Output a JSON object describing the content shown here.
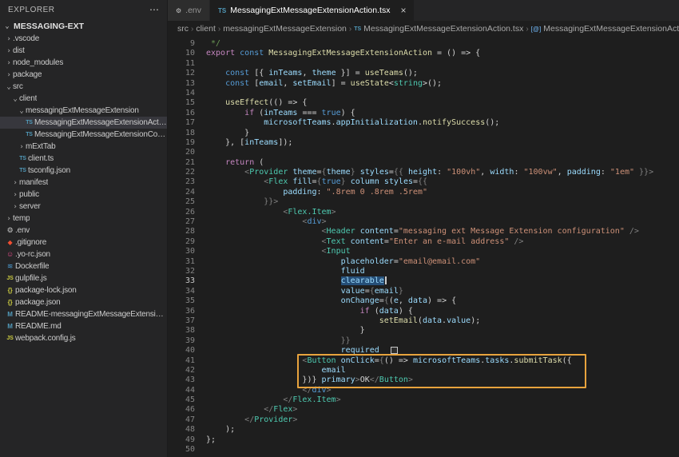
{
  "colors": {
    "accent_box": "#e8a33d",
    "selection": "#264f78"
  },
  "icon_glyphs": {
    "ts": "TS",
    "gear": "⚙",
    "git": "◆",
    "yo": "☺",
    "docker": "≋",
    "js": "JS",
    "json": "{}",
    "md": "M",
    "folder_collapsed": "›",
    "folder_expanded": "⌄",
    "symbol": "[@]",
    "close": "×",
    "more": "⋯",
    "separator": "›"
  },
  "explorer": {
    "title": "EXPLORER",
    "section": "MESSAGING-EXT",
    "items": [
      {
        "label": ".vscode",
        "kind": "folder",
        "indent": 0
      },
      {
        "label": "dist",
        "kind": "folder",
        "indent": 0
      },
      {
        "label": "node_modules",
        "kind": "folder",
        "indent": 0
      },
      {
        "label": "package",
        "kind": "folder",
        "indent": 0
      },
      {
        "label": "src",
        "kind": "folder",
        "indent": 0,
        "expanded": true
      },
      {
        "label": "client",
        "kind": "folder",
        "indent": 1,
        "expanded": true
      },
      {
        "label": "messagingExtMessageExtension",
        "kind": "folder",
        "indent": 2,
        "expanded": true
      },
      {
        "label": "MessagingExtMessageExtensionAction.tsx",
        "kind": "ts",
        "indent": 3,
        "selected": true
      },
      {
        "label": "MessagingExtMessageExtensionConfig.tsx",
        "kind": "ts",
        "indent": 3
      },
      {
        "label": "mExtTab",
        "kind": "folder",
        "indent": 2
      },
      {
        "label": "client.ts",
        "kind": "ts",
        "indent": 2
      },
      {
        "label": "tsconfig.json",
        "kind": "ts",
        "indent": 2
      },
      {
        "label": "manifest",
        "kind": "folder",
        "indent": 1
      },
      {
        "label": "public",
        "kind": "folder",
        "indent": 1
      },
      {
        "label": "server",
        "kind": "folder",
        "indent": 1
      },
      {
        "label": "temp",
        "kind": "folder",
        "indent": 0
      },
      {
        "label": ".env",
        "kind": "gear",
        "indent": 0
      },
      {
        "label": ".gitignore",
        "kind": "git",
        "indent": 0
      },
      {
        "label": ".yo-rc.json",
        "kind": "yo",
        "indent": 0
      },
      {
        "label": "Dockerfile",
        "kind": "docker",
        "indent": 0
      },
      {
        "label": "gulpfile.js",
        "kind": "js",
        "indent": 0
      },
      {
        "label": "package-lock.json",
        "kind": "json",
        "indent": 0
      },
      {
        "label": "package.json",
        "kind": "json",
        "indent": 0
      },
      {
        "label": "README-messagingExtMessageExtensionBot....",
        "kind": "md",
        "indent": 0
      },
      {
        "label": "README.md",
        "kind": "md",
        "indent": 0
      },
      {
        "label": "webpack.config.js",
        "kind": "js",
        "indent": 0
      }
    ]
  },
  "tabs": [
    {
      "label": ".env",
      "icon": "gear",
      "active": false
    },
    {
      "label": "MessagingExtMessageExtensionAction.tsx",
      "icon": "ts",
      "active": true,
      "close_label": "×"
    }
  ],
  "breadcrumbs": [
    {
      "label": "src"
    },
    {
      "label": "client"
    },
    {
      "label": "messagingExtMessageExtension"
    },
    {
      "label": "MessagingExtMessageExtensionAction.tsx",
      "icon": "ts"
    },
    {
      "label": "MessagingExtMessageExtensionAction",
      "icon": "symbol"
    }
  ],
  "editor": {
    "active_line": 33,
    "highlight_lines": {
      "start": 41,
      "end": 43
    },
    "lines": [
      {
        "n": 9,
        "t": [
          [
            " */",
            "cm"
          ]
        ]
      },
      {
        "n": 10,
        "t": [
          [
            "export ",
            "ctl"
          ],
          [
            "const ",
            "kw"
          ],
          [
            "MessagingExtMessageExtensionAction",
            "fn"
          ],
          [
            " = () => {",
            "pl"
          ]
        ]
      },
      {
        "n": 11,
        "t": []
      },
      {
        "n": 12,
        "t": [
          [
            "    ",
            "pl"
          ],
          [
            "const ",
            "kw"
          ],
          [
            "[{ ",
            "pl"
          ],
          [
            "inTeams",
            "var"
          ],
          [
            ", ",
            "pl"
          ],
          [
            "theme",
            "var"
          ],
          [
            " }] = ",
            "pl"
          ],
          [
            "useTeams",
            "fn"
          ],
          [
            "();",
            "pl"
          ]
        ]
      },
      {
        "n": 13,
        "t": [
          [
            "    ",
            "pl"
          ],
          [
            "const ",
            "kw"
          ],
          [
            "[",
            "pl"
          ],
          [
            "email",
            "var"
          ],
          [
            ", ",
            "pl"
          ],
          [
            "setEmail",
            "var"
          ],
          [
            "] = ",
            "pl"
          ],
          [
            "useState",
            "fn"
          ],
          [
            "<",
            "pl"
          ],
          [
            "string",
            "comp"
          ],
          [
            ">();",
            "pl"
          ]
        ]
      },
      {
        "n": 14,
        "t": []
      },
      {
        "n": 15,
        "t": [
          [
            "    ",
            "pl"
          ],
          [
            "useEffect",
            "fn"
          ],
          [
            "(() => {",
            "pl"
          ]
        ]
      },
      {
        "n": 16,
        "t": [
          [
            "        ",
            "pl"
          ],
          [
            "if",
            "ctl"
          ],
          [
            " (",
            "pl"
          ],
          [
            "inTeams",
            "var"
          ],
          [
            " === ",
            "pl"
          ],
          [
            "true",
            "kw"
          ],
          [
            ") {",
            "pl"
          ]
        ]
      },
      {
        "n": 17,
        "t": [
          [
            "            ",
            "pl"
          ],
          [
            "microsoftTeams",
            "var"
          ],
          [
            ".",
            "pl"
          ],
          [
            "appInitialization",
            "var"
          ],
          [
            ".",
            "pl"
          ],
          [
            "notifySuccess",
            "fn"
          ],
          [
            "();",
            "pl"
          ]
        ]
      },
      {
        "n": 18,
        "t": [
          [
            "        }",
            "pl"
          ]
        ]
      },
      {
        "n": 19,
        "t": [
          [
            "    }, [",
            "pl"
          ],
          [
            "inTeams",
            "var"
          ],
          [
            "]);",
            "pl"
          ]
        ]
      },
      {
        "n": 20,
        "t": []
      },
      {
        "n": 21,
        "t": [
          [
            "    ",
            "pl"
          ],
          [
            "return",
            "ctl"
          ],
          [
            " (",
            "pl"
          ]
        ]
      },
      {
        "n": 22,
        "t": [
          [
            "        ",
            "pl"
          ],
          [
            "<",
            "pn"
          ],
          [
            "Provider",
            "comp"
          ],
          [
            " ",
            "pl"
          ],
          [
            "theme",
            "var"
          ],
          [
            "=",
            "pl"
          ],
          [
            "{",
            "pn"
          ],
          [
            "theme",
            "var"
          ],
          [
            "}",
            "pn"
          ],
          [
            " ",
            "pl"
          ],
          [
            "styles",
            "var"
          ],
          [
            "=",
            "pl"
          ],
          [
            "{{ ",
            "pn"
          ],
          [
            "height",
            "var"
          ],
          [
            ": ",
            "pl"
          ],
          [
            "\"100vh\"",
            "str"
          ],
          [
            ", ",
            "pl"
          ],
          [
            "width",
            "var"
          ],
          [
            ": ",
            "pl"
          ],
          [
            "\"100vw\"",
            "str"
          ],
          [
            ", ",
            "pl"
          ],
          [
            "padding",
            "var"
          ],
          [
            ": ",
            "pl"
          ],
          [
            "\"1em\"",
            "str"
          ],
          [
            " }}",
            "pn"
          ],
          [
            ">",
            "pn"
          ]
        ]
      },
      {
        "n": 23,
        "t": [
          [
            "            ",
            "pl"
          ],
          [
            "<",
            "pn"
          ],
          [
            "Flex",
            "comp"
          ],
          [
            " ",
            "pl"
          ],
          [
            "fill",
            "var"
          ],
          [
            "=",
            "pl"
          ],
          [
            "{",
            "pn"
          ],
          [
            "true",
            "kw"
          ],
          [
            "}",
            "pn"
          ],
          [
            " ",
            "pl"
          ],
          [
            "column",
            "var"
          ],
          [
            " ",
            "pl"
          ],
          [
            "styles",
            "var"
          ],
          [
            "=",
            "pl"
          ],
          [
            "{{",
            "pn"
          ]
        ]
      },
      {
        "n": 24,
        "t": [
          [
            "                ",
            "pl"
          ],
          [
            "padding",
            "var"
          ],
          [
            ": ",
            "pl"
          ],
          [
            "\".8rem 0 .8rem .5rem\"",
            "str"
          ]
        ]
      },
      {
        "n": 25,
        "t": [
          [
            "            }}>",
            "pn"
          ]
        ]
      },
      {
        "n": 26,
        "t": [
          [
            "                ",
            "pl"
          ],
          [
            "<",
            "pn"
          ],
          [
            "Flex.Item",
            "comp"
          ],
          [
            ">",
            "pn"
          ]
        ]
      },
      {
        "n": 27,
        "t": [
          [
            "                    ",
            "pl"
          ],
          [
            "<",
            "pn"
          ],
          [
            "div",
            "tag"
          ],
          [
            ">",
            "pn"
          ]
        ]
      },
      {
        "n": 28,
        "t": [
          [
            "                        ",
            "pl"
          ],
          [
            "<",
            "pn"
          ],
          [
            "Header",
            "comp"
          ],
          [
            " ",
            "pl"
          ],
          [
            "content",
            "var"
          ],
          [
            "=",
            "pl"
          ],
          [
            "\"messaging ext Message Extension configuration\"",
            "str"
          ],
          [
            " />",
            "pn"
          ]
        ]
      },
      {
        "n": 29,
        "t": [
          [
            "                        ",
            "pl"
          ],
          [
            "<",
            "pn"
          ],
          [
            "Text",
            "comp"
          ],
          [
            " ",
            "pl"
          ],
          [
            "content",
            "var"
          ],
          [
            "=",
            "pl"
          ],
          [
            "\"Enter an e-mail address\"",
            "str"
          ],
          [
            " />",
            "pn"
          ]
        ]
      },
      {
        "n": 30,
        "t": [
          [
            "                        ",
            "pl"
          ],
          [
            "<",
            "pn"
          ],
          [
            "Input",
            "comp"
          ]
        ]
      },
      {
        "n": 31,
        "t": [
          [
            "                            ",
            "pl"
          ],
          [
            "placeholder",
            "var"
          ],
          [
            "=",
            "pl"
          ],
          [
            "\"email@email.com\"",
            "str"
          ]
        ]
      },
      {
        "n": 32,
        "t": [
          [
            "                            ",
            "pl"
          ],
          [
            "fluid",
            "var"
          ]
        ]
      },
      {
        "n": 33,
        "t": [
          [
            "                            ",
            "pl"
          ],
          [
            "clearable",
            "var sel"
          ]
        ],
        "caret": true
      },
      {
        "n": 34,
        "t": [
          [
            "                            ",
            "pl"
          ],
          [
            "value",
            "var"
          ],
          [
            "=",
            "pl"
          ],
          [
            "{",
            "pn"
          ],
          [
            "email",
            "var"
          ],
          [
            "}",
            "pn"
          ]
        ]
      },
      {
        "n": 35,
        "t": [
          [
            "                            ",
            "pl"
          ],
          [
            "onChange",
            "var"
          ],
          [
            "=",
            "pl"
          ],
          [
            "{",
            "pn"
          ],
          [
            "(",
            "pl"
          ],
          [
            "e",
            "var"
          ],
          [
            ", ",
            "pl"
          ],
          [
            "data",
            "var"
          ],
          [
            ") => {",
            "pl"
          ]
        ]
      },
      {
        "n": 36,
        "t": [
          [
            "                                ",
            "pl"
          ],
          [
            "if",
            "ctl"
          ],
          [
            " (",
            "pl"
          ],
          [
            "data",
            "var"
          ],
          [
            ") {",
            "pl"
          ]
        ]
      },
      {
        "n": 37,
        "t": [
          [
            "                                    ",
            "pl"
          ],
          [
            "setEmail",
            "fn"
          ],
          [
            "(",
            "pl"
          ],
          [
            "data",
            "var"
          ],
          [
            ".",
            "pl"
          ],
          [
            "value",
            "var"
          ],
          [
            ");",
            "pl"
          ]
        ]
      },
      {
        "n": 38,
        "t": [
          [
            "                                }",
            "pl"
          ]
        ]
      },
      {
        "n": 39,
        "t": [
          [
            "                            }}",
            "pn"
          ]
        ]
      },
      {
        "n": 40,
        "t": [
          [
            "                            ",
            "pl"
          ],
          [
            "required",
            "var"
          ]
        ],
        "ghost": true
      },
      {
        "n": 41,
        "t": [
          [
            "                    ",
            "pl"
          ],
          [
            "<",
            "pn"
          ],
          [
            "Button",
            "comp"
          ],
          [
            " ",
            "pl"
          ],
          [
            "onClick",
            "var"
          ],
          [
            "=",
            "pl"
          ],
          [
            "{",
            "pn"
          ],
          [
            "() => ",
            "pl"
          ],
          [
            "microsoftTeams",
            "var"
          ],
          [
            ".",
            "pl"
          ],
          [
            "tasks",
            "var"
          ],
          [
            ".",
            "pl"
          ],
          [
            "submitTask",
            "fn"
          ],
          [
            "({",
            "pl"
          ]
        ]
      },
      {
        "n": 42,
        "t": [
          [
            "                        ",
            "pl"
          ],
          [
            "email",
            "var"
          ]
        ]
      },
      {
        "n": 43,
        "t": [
          [
            "                    ",
            "pl"
          ],
          [
            "})} ",
            "pl"
          ],
          [
            "primary",
            "var"
          ],
          [
            ">",
            "pn"
          ],
          [
            "OK",
            "pl"
          ],
          [
            "</",
            "pn"
          ],
          [
            "Button",
            "comp"
          ],
          [
            ">",
            "pn"
          ]
        ]
      },
      {
        "n": 44,
        "t": [
          [
            "                    ",
            "pl"
          ],
          [
            "</",
            "pn"
          ],
          [
            "div",
            "tag"
          ],
          [
            ">",
            "pn"
          ]
        ]
      },
      {
        "n": 45,
        "t": [
          [
            "                ",
            "pl"
          ],
          [
            "</",
            "pn"
          ],
          [
            "Flex.Item",
            "comp"
          ],
          [
            ">",
            "pn"
          ]
        ]
      },
      {
        "n": 46,
        "t": [
          [
            "            ",
            "pl"
          ],
          [
            "</",
            "pn"
          ],
          [
            "Flex",
            "comp"
          ],
          [
            ">",
            "pn"
          ]
        ]
      },
      {
        "n": 47,
        "t": [
          [
            "        ",
            "pl"
          ],
          [
            "</",
            "pn"
          ],
          [
            "Provider",
            "comp"
          ],
          [
            ">",
            "pn"
          ]
        ]
      },
      {
        "n": 48,
        "t": [
          [
            "    );",
            "pl"
          ]
        ]
      },
      {
        "n": 49,
        "t": [
          [
            "};",
            "pl"
          ]
        ]
      },
      {
        "n": 50,
        "t": []
      }
    ]
  }
}
